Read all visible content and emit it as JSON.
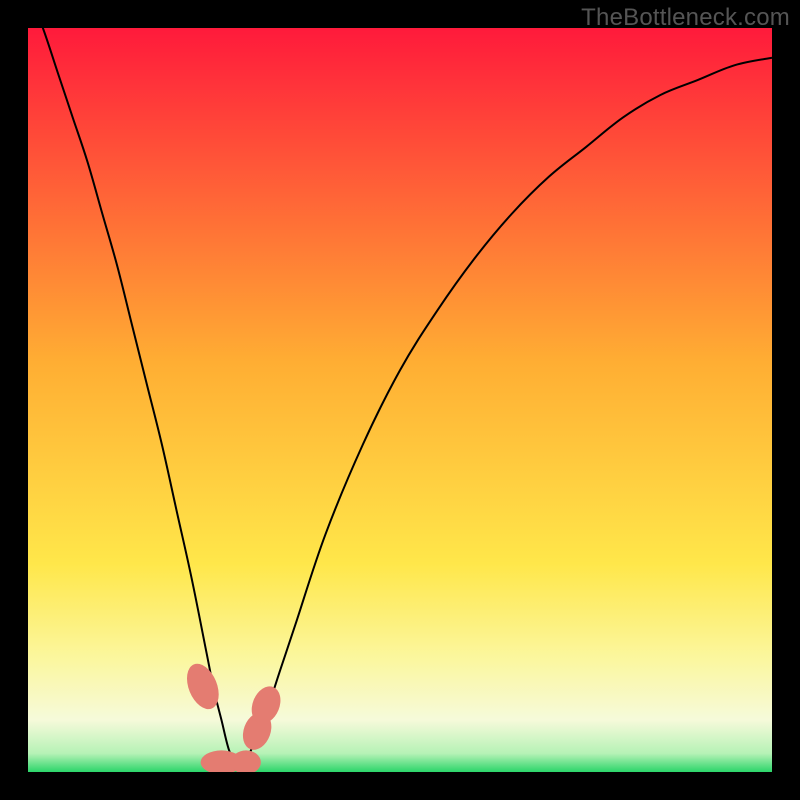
{
  "watermark": "TheBottleneck.com",
  "chart_data": {
    "type": "line",
    "title": "",
    "xlabel": "",
    "ylabel": "",
    "xlim": [
      0,
      100
    ],
    "ylim": [
      0,
      100
    ],
    "grid": false,
    "gradient_stops": [
      {
        "offset": 0,
        "color": "#ff1a3b"
      },
      {
        "offset": 0.45,
        "color": "#ffae33"
      },
      {
        "offset": 0.72,
        "color": "#ffe74a"
      },
      {
        "offset": 0.85,
        "color": "#fbf7a0"
      },
      {
        "offset": 0.93,
        "color": "#f6fada"
      },
      {
        "offset": 0.975,
        "color": "#b6f2b6"
      },
      {
        "offset": 1.0,
        "color": "#2bd56a"
      }
    ],
    "series": [
      {
        "name": "bottleneck-curve",
        "color": "#000000",
        "x": [
          0,
          2,
          4,
          6,
          8,
          10,
          12,
          14,
          16,
          18,
          20,
          22,
          24,
          25,
          26,
          27,
          28,
          29,
          30,
          32,
          34,
          36,
          40,
          45,
          50,
          55,
          60,
          65,
          70,
          75,
          80,
          85,
          90,
          95,
          100
        ],
        "y": [
          105,
          100,
          94,
          88,
          82,
          75,
          68,
          60,
          52,
          44,
          35,
          26,
          16,
          11,
          7,
          3,
          1,
          1,
          3,
          8,
          14,
          20,
          32,
          44,
          54,
          62,
          69,
          75,
          80,
          84,
          88,
          91,
          93,
          95,
          96
        ]
      }
    ],
    "markers": [
      {
        "x": 23.5,
        "y": 11.5,
        "rx": 1.9,
        "ry": 3.2,
        "angle": -22
      },
      {
        "x": 26.0,
        "y": 1.3,
        "rx": 2.8,
        "ry": 1.6,
        "angle": 0
      },
      {
        "x": 29.3,
        "y": 1.3,
        "rx": 2.0,
        "ry": 1.6,
        "angle": 0
      },
      {
        "x": 30.8,
        "y": 5.5,
        "rx": 1.8,
        "ry": 2.6,
        "angle": 20
      },
      {
        "x": 32.0,
        "y": 9.0,
        "rx": 1.8,
        "ry": 2.6,
        "angle": 22
      }
    ]
  }
}
